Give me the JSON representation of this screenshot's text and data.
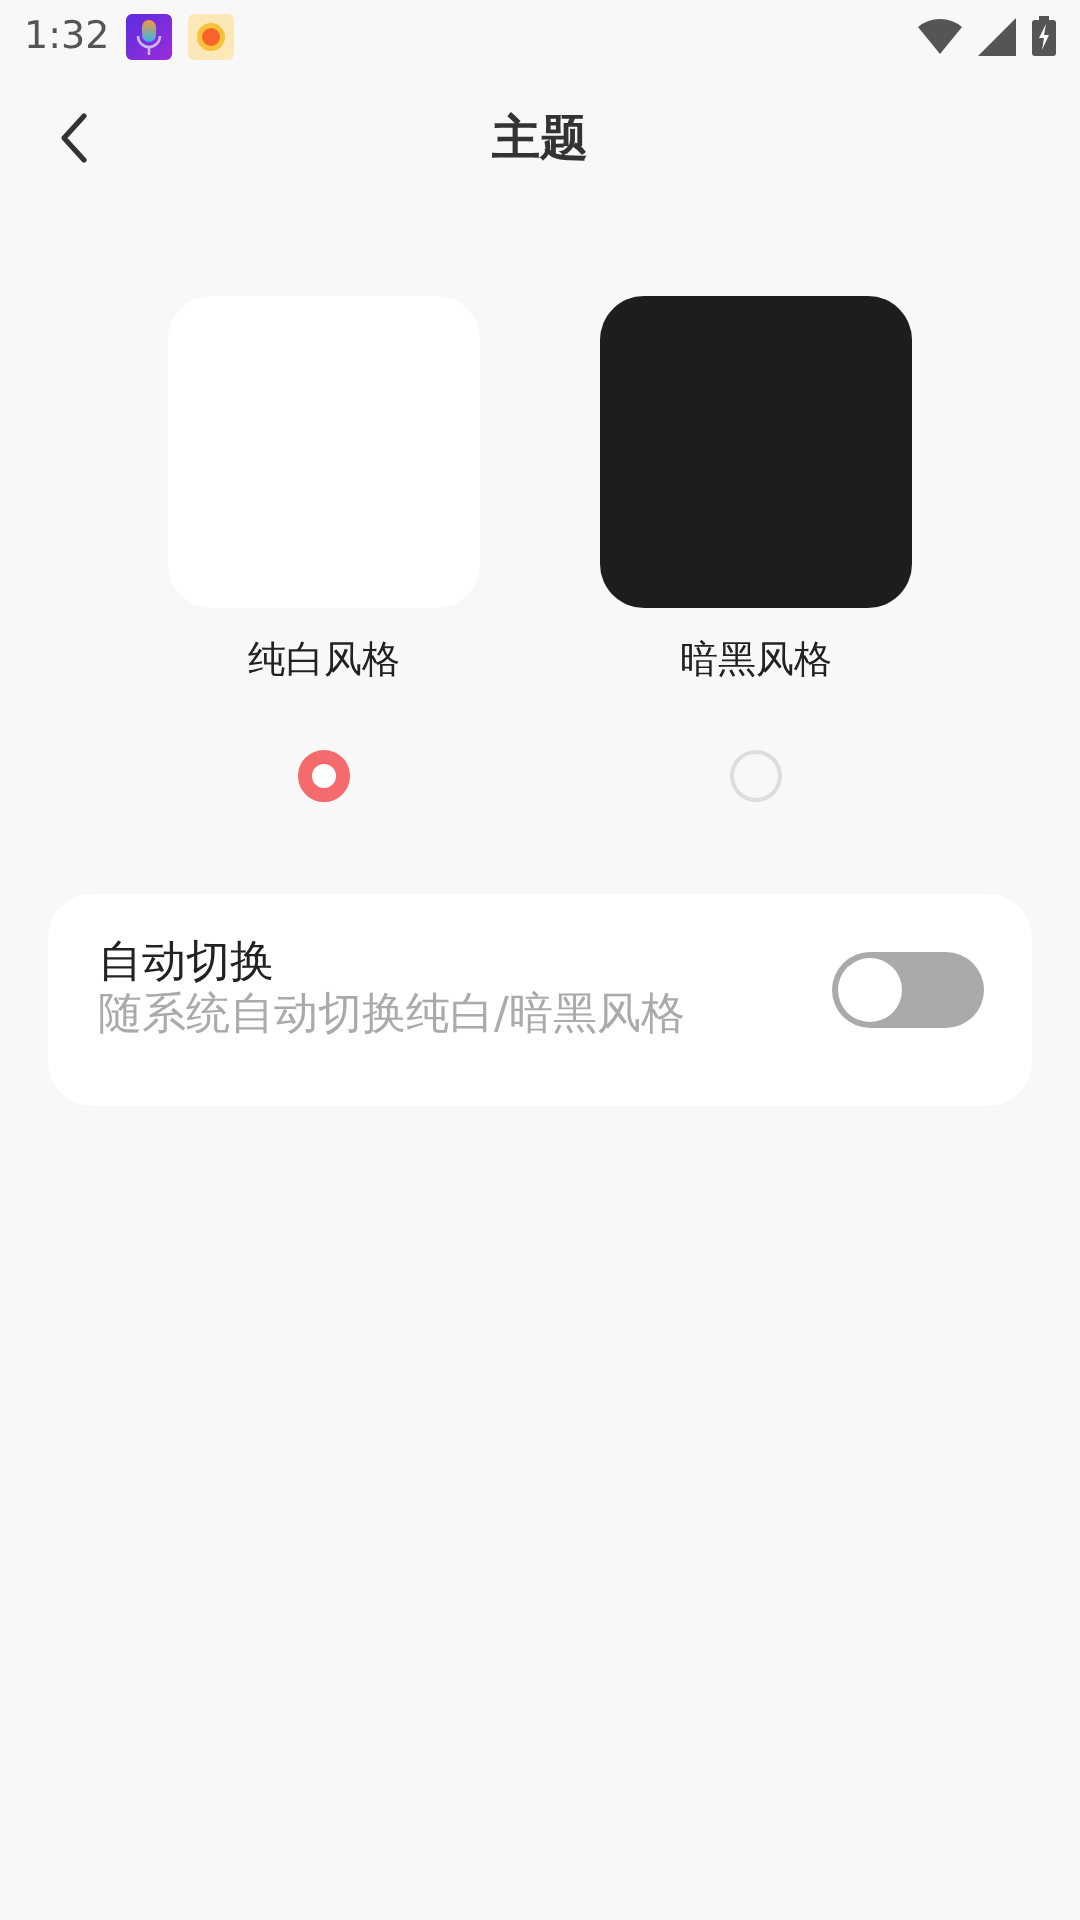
{
  "status_bar": {
    "time": "1:32"
  },
  "header": {
    "title": "主题"
  },
  "themes": [
    {
      "label": "纯白风格",
      "color": "#ffffff",
      "selected": true
    },
    {
      "label": "暗黑风格",
      "color": "#1d1d1f",
      "selected": false
    }
  ],
  "auto_switch": {
    "title": "自动切换",
    "subtitle": "随系统自动切换纯白/暗黑风格",
    "on": false
  }
}
